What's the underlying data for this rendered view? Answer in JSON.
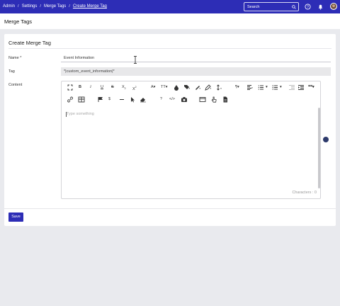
{
  "breadcrumb": {
    "items": [
      "Admin",
      "Settings",
      "Merge Tags",
      "Create Merge Tag"
    ],
    "separator": "/"
  },
  "header": {
    "search_placeholder": "Search",
    "icons": [
      "search-icon",
      "help-icon",
      "bell-icon",
      "avatar"
    ]
  },
  "page": {
    "title": "Merge Tags"
  },
  "form": {
    "title": "Create Merge Tag",
    "name_label": "Name *",
    "name_value": "Event Information",
    "tag_label": "Tag",
    "tag_value": "*|custom_event_information|*",
    "content_label": "Content",
    "editor_placeholder": "Type something",
    "characters_label": "Characters : 0",
    "save_label": "Save",
    "toolbar_text": {
      "subscript": "X",
      "superscript": "X",
      "font_color": "A",
      "font_size": "TT",
      "special_char": "Ω",
      "help": "?",
      "quote": "❝❝"
    }
  },
  "colors": {
    "brand": "#2d2db6",
    "background": "#e9eaee"
  }
}
